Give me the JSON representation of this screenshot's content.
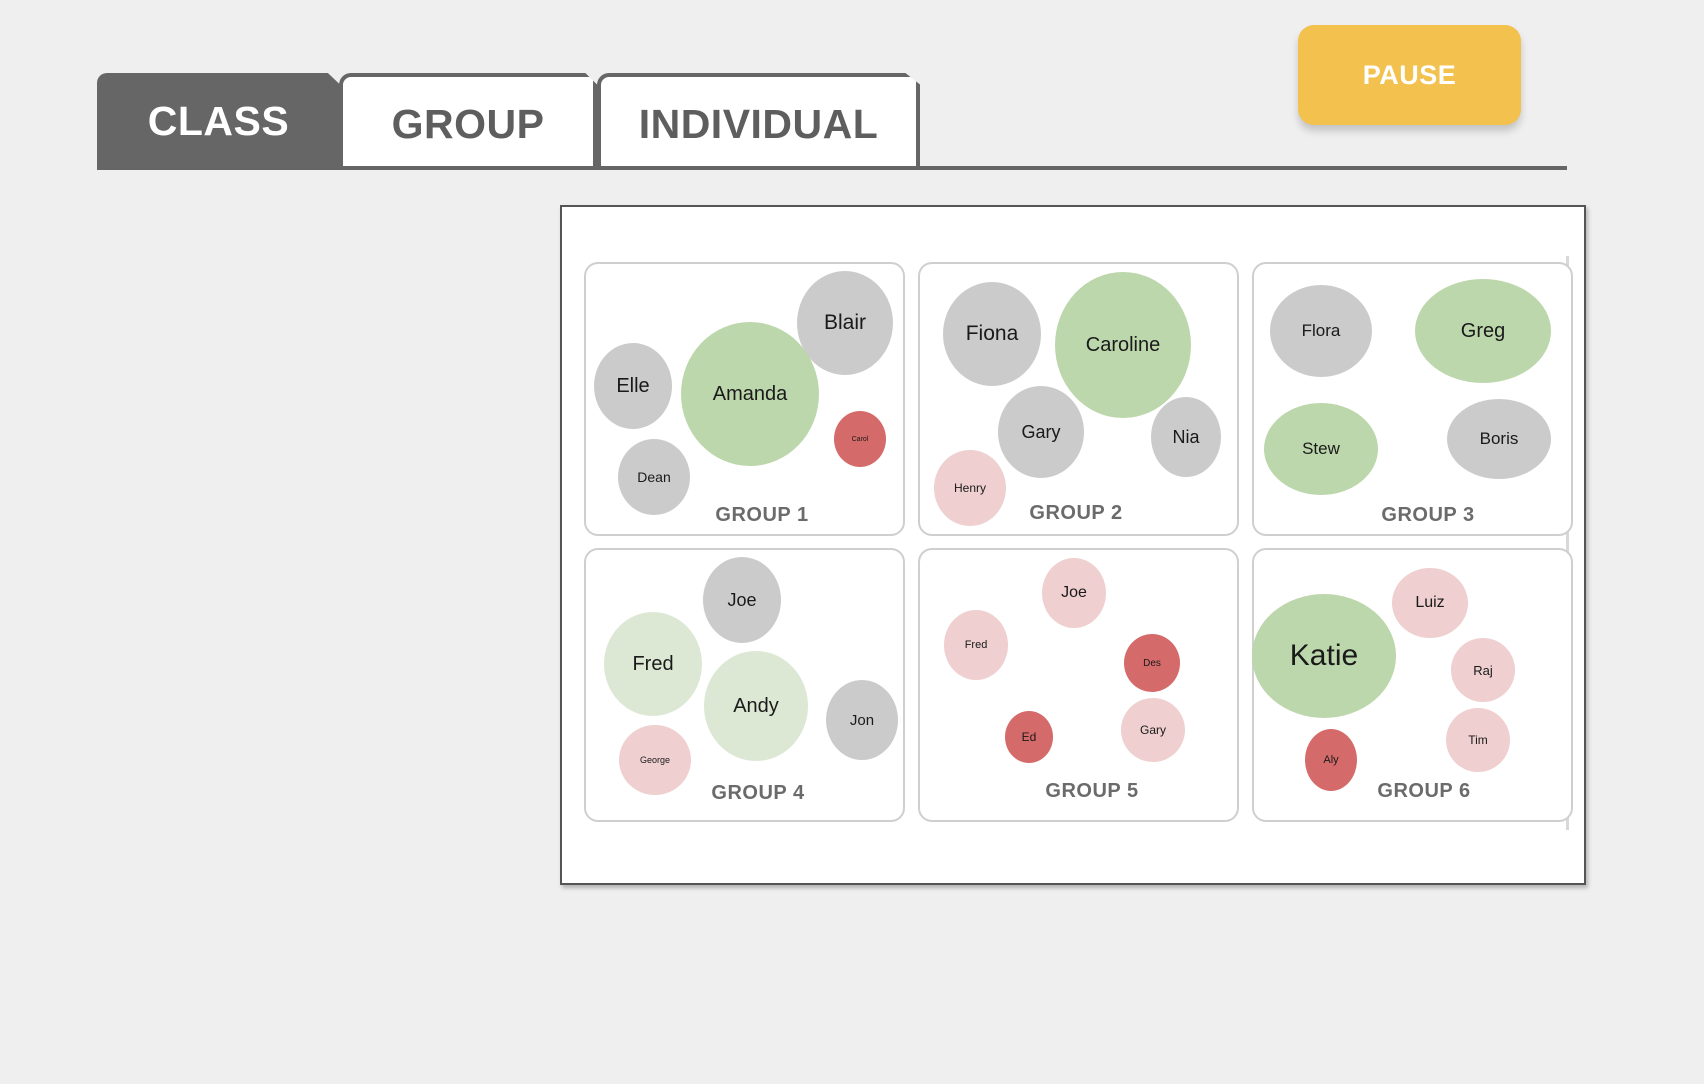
{
  "tabs": [
    {
      "label": "CLASS",
      "active": true
    },
    {
      "label": "GROUP",
      "active": false
    },
    {
      "label": "INDIVIDUAL",
      "active": false
    }
  ],
  "pause_label": "PAUSE",
  "colors": {
    "green": "#bcd7ab",
    "light_green": "#dce8d4",
    "gray": "#cbcbcb",
    "pink": "#efcfcf",
    "red": "#d56a6a",
    "accent": "#f2c14e"
  },
  "groups": [
    {
      "label": "GROUP 1",
      "members": [
        {
          "name": "Blair",
          "status": "gray"
        },
        {
          "name": "Elle",
          "status": "gray"
        },
        {
          "name": "Amanda",
          "status": "green"
        },
        {
          "name": "Carol",
          "status": "red"
        },
        {
          "name": "Dean",
          "status": "gray"
        }
      ]
    },
    {
      "label": "GROUP 2",
      "members": [
        {
          "name": "Fiona",
          "status": "gray"
        },
        {
          "name": "Caroline",
          "status": "green"
        },
        {
          "name": "Gary",
          "status": "gray"
        },
        {
          "name": "Nia",
          "status": "gray"
        },
        {
          "name": "Henry",
          "status": "pink"
        }
      ]
    },
    {
      "label": "GROUP 3",
      "members": [
        {
          "name": "Flora",
          "status": "gray"
        },
        {
          "name": "Greg",
          "status": "green"
        },
        {
          "name": "Stew",
          "status": "green"
        },
        {
          "name": "Boris",
          "status": "gray"
        }
      ]
    },
    {
      "label": "GROUP 4",
      "members": [
        {
          "name": "Joe",
          "status": "gray"
        },
        {
          "name": "Fred",
          "status": "light_green"
        },
        {
          "name": "Andy",
          "status": "light_green"
        },
        {
          "name": "Jon",
          "status": "gray"
        },
        {
          "name": "George",
          "status": "pink"
        }
      ]
    },
    {
      "label": "GROUP 5",
      "members": [
        {
          "name": "Joe",
          "status": "pink"
        },
        {
          "name": "Fred",
          "status": "pink"
        },
        {
          "name": "Des",
          "status": "red"
        },
        {
          "name": "Ed",
          "status": "red"
        },
        {
          "name": "Gary",
          "status": "pink"
        }
      ]
    },
    {
      "label": "GROUP 6",
      "members": [
        {
          "name": "Luiz",
          "status": "pink"
        },
        {
          "name": "Katie",
          "status": "green"
        },
        {
          "name": "Raj",
          "status": "pink"
        },
        {
          "name": "Tim",
          "status": "pink"
        },
        {
          "name": "Aly",
          "status": "red"
        }
      ]
    }
  ]
}
